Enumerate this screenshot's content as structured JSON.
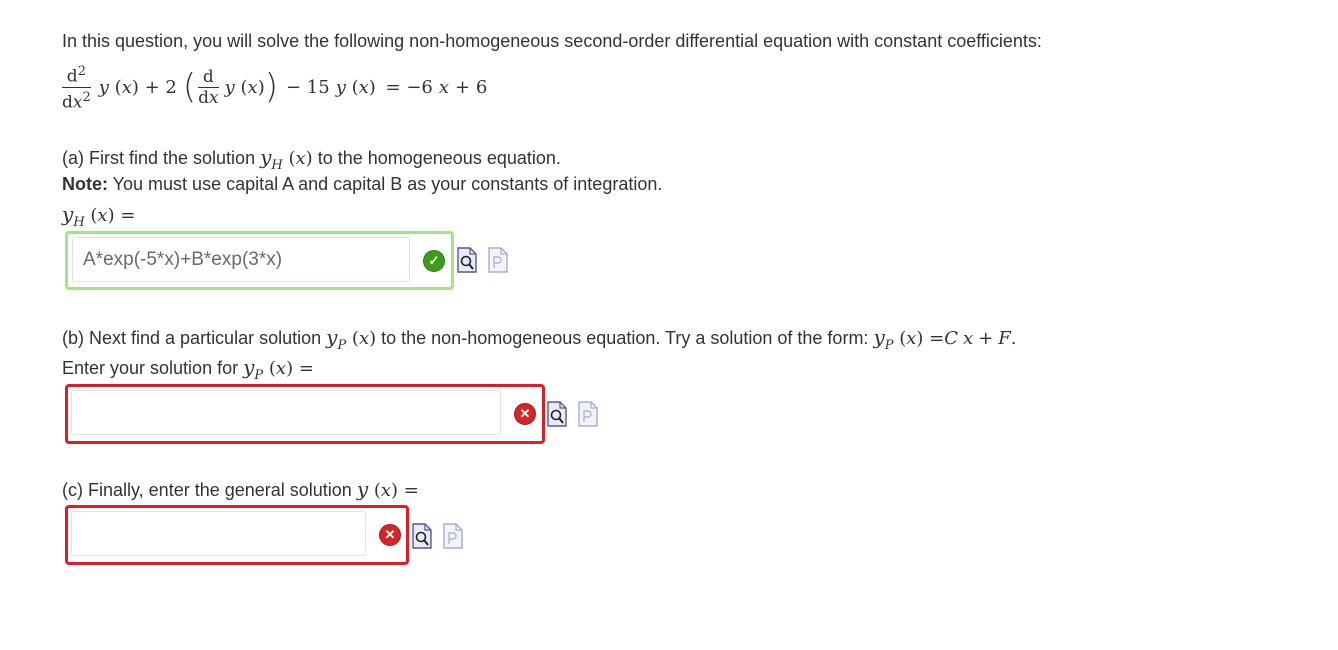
{
  "intro": "In this question, you will solve the following non-homogeneous second-order differential equation with constant coefficients:",
  "equation": {
    "d2": "d",
    "d2_exp": "2",
    "dx2": "d",
    "dx2_x": "x",
    "dx2_exp": "2",
    "y1": "y",
    "x1": "x",
    "plus": "+ 2",
    "d1": "d",
    "dx1": "d",
    "dx1_x": "x",
    "y2": "y",
    "x2": "x",
    "minus15": "− 15",
    "y3": "y",
    "x3": "x",
    "rhs": "= −6",
    "rhs_x": "x",
    "rhs_plus6": "+ 6"
  },
  "part_a": {
    "text_before": "(a) First find the solution ",
    "y": "y",
    "sub": "H",
    "x": "x",
    "text_after": " to the homogeneous equation.",
    "note_bold": "Note:",
    "note_text": " You must use capital A and capital B as your constants of integration.",
    "label_y": "y",
    "label_sub": "H",
    "label_x": "x",
    "label_eq": "=",
    "answer_value": "A*exp(-5*x)+B*exp(3*x)",
    "status": "correct"
  },
  "part_b": {
    "text_before": "(b) Next find a particular solution ",
    "y": "y",
    "sub": "P",
    "x": "x",
    "text_mid": " to the non-homogeneous equation. Try a solution of the form: ",
    "form_y": "y",
    "form_sub": "P",
    "form_x": "x",
    "form_eq": "=",
    "form_C": "C",
    "form_x2": "x",
    "form_plus": "+",
    "form_F": "F",
    "form_period": ".",
    "enter_text": "Enter your solution for ",
    "enter_y": "y",
    "enter_sub": "P",
    "enter_x": "x",
    "enter_eq": "=",
    "answer_value": "",
    "status": "incorrect"
  },
  "part_c": {
    "text": "(c) Finally, enter the general solution ",
    "y": "y",
    "x": "x",
    "eq": "=",
    "answer_value": "",
    "status": "incorrect"
  },
  "icons": {
    "correct": "check-circle-icon",
    "incorrect": "x-circle-icon",
    "preview": "preview-document-icon",
    "pdf": "pdf-document-icon"
  },
  "symbols": {
    "check": "✓",
    "cross": "✕"
  },
  "colors": {
    "correct_border": "#a3e38a",
    "incorrect_border": "#d92024",
    "correct_icon": "#3d9c1e",
    "incorrect_icon": "#d2272a"
  }
}
